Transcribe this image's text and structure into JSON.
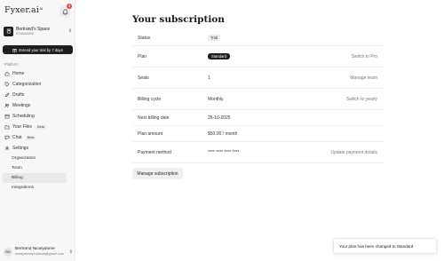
{
  "brand": {
    "name": "Fyxer.ai",
    "sup": "AI"
  },
  "notifications": {
    "count": "3"
  },
  "workspace": {
    "name": "Bertrand's Space",
    "plan": "STANDARD"
  },
  "trial_button": {
    "label": "Extend your trial by 7 days"
  },
  "sidebar": {
    "section_label": "Platform",
    "items": [
      {
        "label": "Home",
        "icon": "home-icon"
      },
      {
        "label": "Categorization",
        "icon": "tag-icon"
      },
      {
        "label": "Drafts",
        "icon": "pencil-icon"
      },
      {
        "label": "Meetings",
        "icon": "people-icon"
      },
      {
        "label": "Scheduling",
        "icon": "calendar-icon"
      },
      {
        "label": "Your Files",
        "icon": "folder-icon",
        "badge": "Beta"
      },
      {
        "label": "Chat",
        "icon": "chat-icon",
        "badge": "Beta"
      },
      {
        "label": "Settings",
        "icon": "gear-icon"
      }
    ],
    "settings_subitems": [
      {
        "label": "Organization"
      },
      {
        "label": "Team"
      },
      {
        "label": "Billing",
        "active": true
      },
      {
        "label": "Integrations"
      }
    ]
  },
  "user": {
    "initials": "BN",
    "name": "Bertrand Nicelydome",
    "email": "nicelydomeproducts@gmail.com"
  },
  "main": {
    "title": "Your subscription",
    "rows": [
      {
        "label": "Status",
        "value": "Trial",
        "action": ""
      },
      {
        "label": "Plan",
        "value": "Standard",
        "action": "Switch to Pro"
      },
      {
        "label": "Seats",
        "value": "1",
        "action": "Manage team"
      },
      {
        "label": "Billing cycle",
        "value": "Monthly",
        "action": "Switch to yearly"
      },
      {
        "label": "Next billing date",
        "value": "26-10-2025",
        "action": ""
      },
      {
        "label": "Plan amount",
        "value": "$50.00 / month",
        "action": ""
      },
      {
        "label": "Payment method",
        "value": "**** **** **** ****",
        "action": "Update payment details"
      }
    ],
    "manage_button": "Manage subscription"
  },
  "toast": {
    "message": "Your plan has been changed to Standard"
  },
  "colors": {
    "dark": "#1f1f1f",
    "badge_red": "#e5484d",
    "sidebar_bg": "#f7f7f7"
  }
}
